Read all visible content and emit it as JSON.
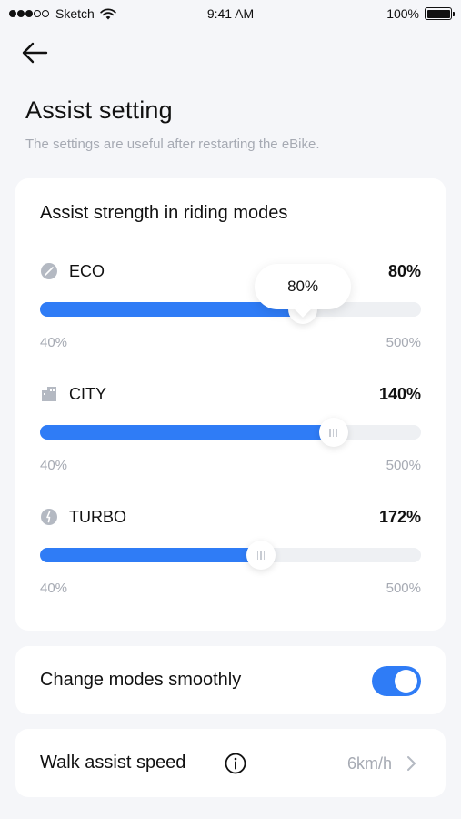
{
  "status_bar": {
    "carrier": "Sketch",
    "time": "9:41 AM",
    "battery": "100%"
  },
  "header": {
    "title": "Assist setting",
    "subtitle": "The settings are useful after restarting the eBike."
  },
  "assist_card": {
    "heading": "Assist strength in riding modes",
    "modes": [
      {
        "name": "ECO",
        "value": "80%",
        "min": "40%",
        "max": "500%",
        "fill_percent": 69,
        "tooltip": "80%",
        "icon": "leaf-icon"
      },
      {
        "name": "CITY",
        "value": "140%",
        "min": "40%",
        "max": "500%",
        "fill_percent": 77,
        "icon": "building-icon"
      },
      {
        "name": "TURBO",
        "value": "172%",
        "min": "40%",
        "max": "500%",
        "fill_percent": 58,
        "icon": "lightning-icon"
      }
    ]
  },
  "smooth_card": {
    "label": "Change modes smoothly",
    "enabled": true
  },
  "walk_card": {
    "label": "Walk assist speed",
    "value": "6km/h"
  },
  "colors": {
    "accent": "#2f7cf6",
    "background": "#f5f6f9",
    "muted_text": "#a6aab3",
    "track": "#eef0f3"
  }
}
